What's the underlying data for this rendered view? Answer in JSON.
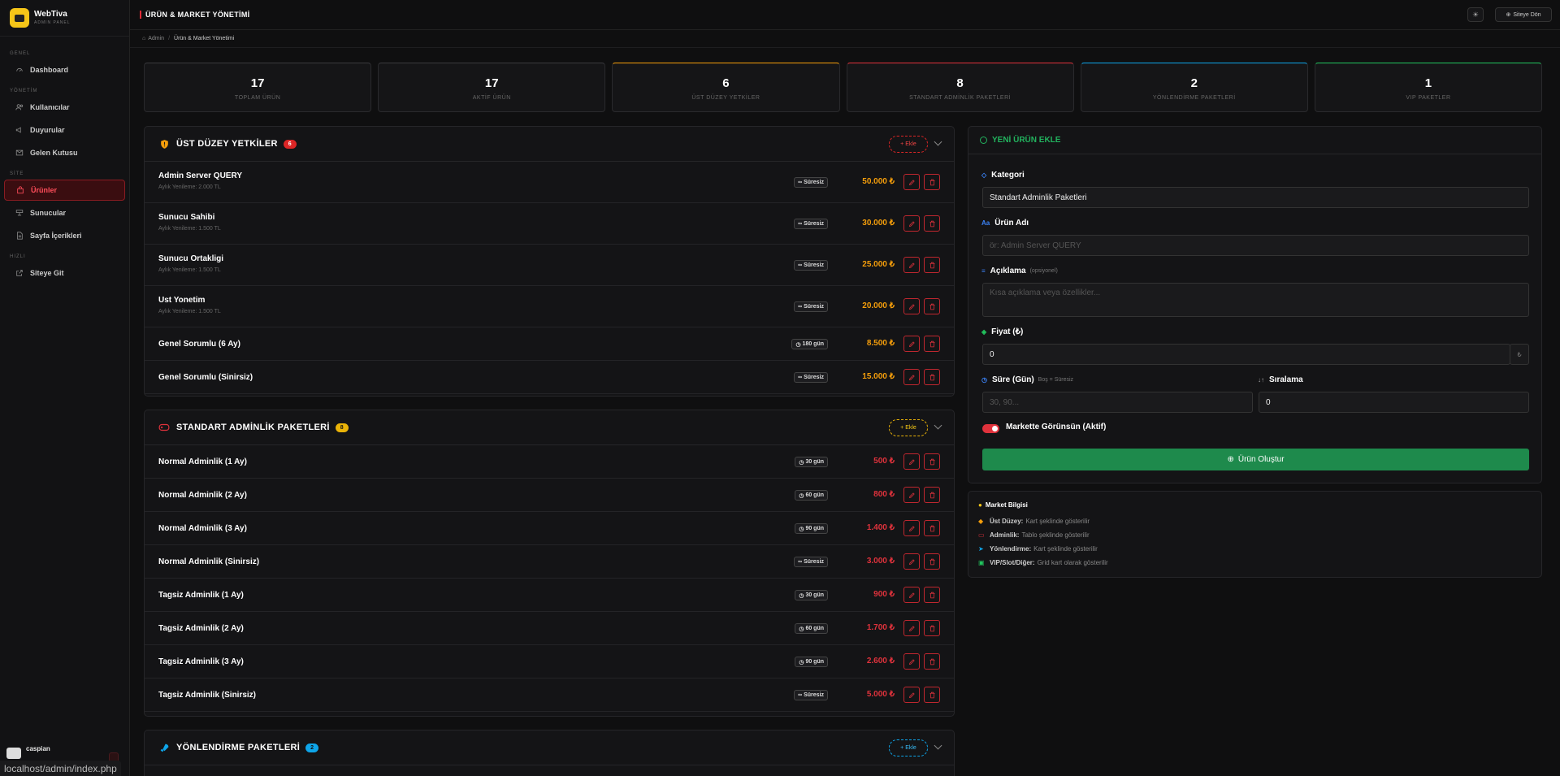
{
  "brand": {
    "name": "WebTiva",
    "sub": "ADMIN PANEL"
  },
  "nav": {
    "sec_general": "GENEL",
    "dashboard": "Dashboard",
    "sec_manage": "YÖNETİM",
    "users": "Kullanıcılar",
    "announcements": "Duyurular",
    "inbox": "Gelen Kutusu",
    "sec_site": "SİTE",
    "products": "Ürünler",
    "servers": "Sunucular",
    "pages": "Sayfa İçerikleri",
    "sec_quick": "HIZLI",
    "go_site": "Siteye Git"
  },
  "user": {
    "name": "caspian"
  },
  "status_url": "localhost/admin/index.php",
  "topbar": {
    "title": "ÜRÜN & MARKET YÖNETİMİ",
    "site_button": "Siteye Dön"
  },
  "breadcrumb": {
    "root": "Admin",
    "current": "Ürün & Market Yönetimi"
  },
  "stats": [
    {
      "value": "17",
      "label": "TOPLAM ÜRÜN",
      "color": "#3a3a3e"
    },
    {
      "value": "17",
      "label": "AKTİF ÜRÜN",
      "color": "#3a3a3e"
    },
    {
      "value": "6",
      "label": "ÜST DÜZEY YETKİLER",
      "color": "#f59e0b"
    },
    {
      "value": "8",
      "label": "STANDART ADMİNLİK PAKETLERİ",
      "color": "#e0323c"
    },
    {
      "value": "2",
      "label": "YÖNLENDİRME PAKETLERİ",
      "color": "#0ea5e9"
    },
    {
      "value": "1",
      "label": "VIP PAKETLER",
      "color": "#22c55e"
    }
  ],
  "sections": {
    "ust": {
      "title": "ÜST DÜZEY YETKİLER",
      "count": "6",
      "add": "Ekle",
      "color": "#f59e0b",
      "badge_bg": "#dc2626"
    },
    "std": {
      "title": "STANDART ADMİNLİK PAKETLERİ",
      "count": "8",
      "add": "Ekle",
      "color": "#f0b90b",
      "badge_bg": "#eab308"
    },
    "yon": {
      "title": "YÖNLENDİRME PAKETLERİ",
      "count": "2",
      "add": "Ekle",
      "color": "#0ea5e9",
      "badge_bg": "#0ea5e9"
    }
  },
  "ust_products": [
    {
      "name": "Admin Server QUERY",
      "sub": "Aylık Yenileme: 2.000 TL",
      "duration": "Süresiz",
      "price": "50.000 ₺"
    },
    {
      "name": "Sunucu Sahibi",
      "sub": "Aylık Yenileme: 1.500 TL",
      "duration": "Süresiz",
      "price": "30.000 ₺"
    },
    {
      "name": "Sunucu Ortakligi",
      "sub": "Aylık Yenileme: 1.500 TL",
      "duration": "Süresiz",
      "price": "25.000 ₺"
    },
    {
      "name": "Ust Yonetim",
      "sub": "Aylık Yenileme: 1.500 TL",
      "duration": "Süresiz",
      "price": "20.000 ₺"
    },
    {
      "name": "Genel Sorumlu (6 Ay)",
      "sub": "",
      "duration": "180 gün",
      "price": "8.500 ₺"
    },
    {
      "name": "Genel Sorumlu (Sinirsiz)",
      "sub": "",
      "duration": "Süresiz",
      "price": "15.000 ₺"
    }
  ],
  "std_products": [
    {
      "name": "Normal Adminlik (1 Ay)",
      "duration": "30 gün",
      "price": "500 ₺"
    },
    {
      "name": "Normal Adminlik (2 Ay)",
      "duration": "60 gün",
      "price": "800 ₺"
    },
    {
      "name": "Normal Adminlik (3 Ay)",
      "duration": "90 gün",
      "price": "1.400 ₺"
    },
    {
      "name": "Normal Adminlik (Sinirsiz)",
      "duration": "Süresiz",
      "price": "3.000 ₺"
    },
    {
      "name": "Tagsiz Adminlik (1 Ay)",
      "duration": "30 gün",
      "price": "900 ₺"
    },
    {
      "name": "Tagsiz Adminlik (2 Ay)",
      "duration": "60 gün",
      "price": "1.700 ₺"
    },
    {
      "name": "Tagsiz Adminlik (3 Ay)",
      "duration": "90 gün",
      "price": "2.600 ₺"
    },
    {
      "name": "Tagsiz Adminlik (Sinirsiz)",
      "duration": "Süresiz",
      "price": "5.000 ₺"
    }
  ],
  "form": {
    "title": "YENİ ÜRÜN EKLE",
    "category_label": "Kategori",
    "category_value": "Standart Adminlik Paketleri",
    "name_label": "Ürün Adı",
    "name_placeholder": "ör: Admin Server QUERY",
    "desc_label": "Açıklama",
    "desc_optional": "(opsiyonel)",
    "desc_placeholder": "Kısa açıklama veya özellikler...",
    "price_label": "Fiyat (₺)",
    "price_value": "0",
    "duration_label": "Süre (Gün)",
    "duration_hint": "Boş = Süresiz",
    "duration_placeholder": "30, 90...",
    "order_label": "Sıralama",
    "order_value": "0",
    "visible_label": "Markette Görünsün (Aktif)",
    "submit": "Ürün Oluştur"
  },
  "info": {
    "title": "Market Bilgisi",
    "rows": [
      {
        "key": "Üst Düzey:",
        "text": "Kart şeklinde gösterilir"
      },
      {
        "key": "Adminlik:",
        "text": "Tablo şeklinde gösterilir"
      },
      {
        "key": "Yönlendirme:",
        "text": "Kart şeklinde gösterilir"
      },
      {
        "key": "VIP/Slot/Diğer:",
        "text": "Grid kart olarak gösterilir"
      }
    ]
  }
}
